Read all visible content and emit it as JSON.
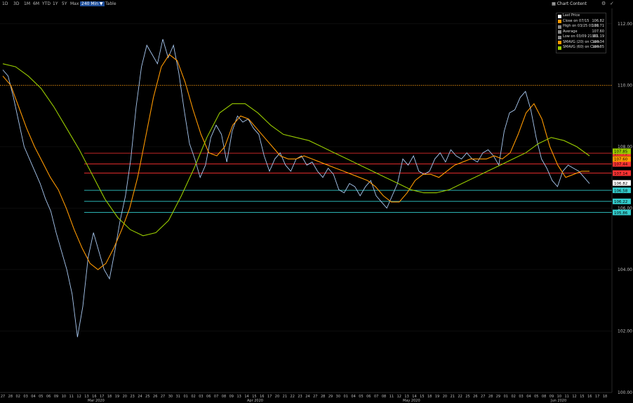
{
  "toolbar": {
    "timeframes": [
      "1D",
      "3D",
      "1M",
      "6M",
      "YTD",
      "1Y",
      "5Y",
      "Max",
      "240 Min ▼",
      "Table"
    ],
    "active": "240 Min ▼",
    "chart_content": "Chart Content"
  },
  "legend": [
    {
      "name": "Last Price",
      "value": "",
      "color": "#ffffff"
    },
    {
      "name": "Close on 07/15",
      "value": "106.82",
      "color": "#ff9900"
    },
    {
      "name": "High on 03/25 01:00",
      "value": "111.71",
      "color": "#888888"
    },
    {
      "name": "Average",
      "value": "107.60",
      "color": "#888888"
    },
    {
      "name": "Low on 03/09 21:00",
      "value": "101.19",
      "color": "#888888"
    },
    {
      "name": "SMAVG (20) on Close",
      "value": "107.34",
      "color": "#ff9900"
    },
    {
      "name": "SMAVG (60) on Close",
      "value": "107.85",
      "color": "#99cc00"
    }
  ],
  "chart_data": {
    "type": "line",
    "ylim": [
      100,
      112.5
    ],
    "yticks": [
      100,
      102,
      104,
      106,
      108,
      110,
      112
    ],
    "ytick_labels": [
      "100.00",
      "102.00",
      "104.00",
      "106.00",
      "108.00",
      "110.00",
      "112.00"
    ],
    "day_labels": [
      "27",
      "28",
      "02",
      "03",
      "04",
      "05",
      "06",
      "09",
      "10",
      "11",
      "12",
      "13",
      "16",
      "17",
      "18",
      "19",
      "20",
      "23",
      "24",
      "25",
      "26",
      "27",
      "30",
      "31",
      "01",
      "02",
      "03",
      "06",
      "07",
      "08",
      "09",
      "13",
      "14",
      "15",
      "16",
      "17",
      "20",
      "21",
      "22",
      "23",
      "24",
      "27",
      "28",
      "29",
      "30",
      "01",
      "04",
      "05",
      "06",
      "07",
      "08",
      "11",
      "12",
      "13",
      "14",
      "15",
      "18",
      "19",
      "20",
      "21",
      "22",
      "25",
      "26",
      "27",
      "28",
      "29",
      "01",
      "02",
      "03",
      "04",
      "05",
      "08",
      "09",
      "10",
      "11",
      "12",
      "15",
      "16",
      "17",
      "18"
    ],
    "month_labels": [
      "Mar 2020",
      "Apr 2020",
      "May 2020",
      "Jun 2020"
    ],
    "series": [
      {
        "name": "Last Price",
        "color": "#a8c8f0",
        "values": [
          110.5,
          110.3,
          109.6,
          108.8,
          108.0,
          107.6,
          107.2,
          106.8,
          106.3,
          105.9,
          105.2,
          104.6,
          104.0,
          103.2,
          101.8,
          102.8,
          104.4,
          105.2,
          104.6,
          104.0,
          103.7,
          104.6,
          105.6,
          106.4,
          107.6,
          109.3,
          110.6,
          111.3,
          111.0,
          110.7,
          111.5,
          110.9,
          111.3,
          110.4,
          109.2,
          108.1,
          107.6,
          107.0,
          107.4,
          108.3,
          108.7,
          108.4,
          107.5,
          108.5,
          109.0,
          108.8,
          108.9,
          108.6,
          108.4,
          107.7,
          107.2,
          107.6,
          107.8,
          107.4,
          107.2,
          107.6,
          107.7,
          107.4,
          107.5,
          107.2,
          107.0,
          107.3,
          107.1,
          106.6,
          106.5,
          106.8,
          106.7,
          106.4,
          106.7,
          106.9,
          106.4,
          106.2,
          106.0,
          106.4,
          106.8,
          107.6,
          107.4,
          107.7,
          107.2,
          107.1,
          107.2,
          107.6,
          107.8,
          107.5,
          107.9,
          107.7,
          107.6,
          107.8,
          107.6,
          107.5,
          107.8,
          107.9,
          107.7,
          107.4,
          108.5,
          109.1,
          109.2,
          109.6,
          109.8,
          109.2,
          108.3,
          107.6,
          107.3,
          106.9,
          106.7,
          107.2,
          107.4,
          107.3,
          107.2,
          107.0,
          106.8
        ]
      },
      {
        "name": "SMAVG (20) on Close",
        "color": "#ff9900",
        "values": [
          110.3,
          110.0,
          109.3,
          108.6,
          108.0,
          107.5,
          107.0,
          106.6,
          106.0,
          105.3,
          104.7,
          104.2,
          104.0,
          104.2,
          104.7,
          105.3,
          106.0,
          107.0,
          108.3,
          109.6,
          110.6,
          111.0,
          110.8,
          110.1,
          109.2,
          108.4,
          107.8,
          107.7,
          108.0,
          108.7,
          109.0,
          108.9,
          108.6,
          108.3,
          108.0,
          107.7,
          107.6,
          107.6,
          107.7,
          107.6,
          107.5,
          107.4,
          107.3,
          107.2,
          107.1,
          107.0,
          106.9,
          106.7,
          106.4,
          106.2,
          106.2,
          106.5,
          106.9,
          107.1,
          107.1,
          107.0,
          107.2,
          107.4,
          107.5,
          107.6,
          107.6,
          107.6,
          107.7,
          107.6,
          107.8,
          108.4,
          109.1,
          109.4,
          108.9,
          108.0,
          107.4,
          107.0,
          107.1,
          107.2,
          107.2
        ]
      },
      {
        "name": "SMAVG (60) on Close",
        "color": "#99cc00",
        "values": [
          110.7,
          110.6,
          110.3,
          109.9,
          109.3,
          108.6,
          107.9,
          107.1,
          106.3,
          105.7,
          105.3,
          105.1,
          105.2,
          105.6,
          106.4,
          107.3,
          108.3,
          109.1,
          109.4,
          109.4,
          109.1,
          108.7,
          108.4,
          108.3,
          108.2,
          108.0,
          107.8,
          107.6,
          107.4,
          107.2,
          107.0,
          106.8,
          106.6,
          106.5,
          106.5,
          106.6,
          106.8,
          107.0,
          107.2,
          107.4,
          107.6,
          107.8,
          108.1,
          108.3,
          108.2,
          108.0,
          107.7
        ]
      }
    ],
    "horizontal_lines": [
      {
        "value": 110.0,
        "color": "#ff9900",
        "style": "dotted",
        "label": "110.00"
      },
      {
        "value": 107.79,
        "color": "#ff3333",
        "label": "107.79"
      },
      {
        "value": 107.44,
        "color": "#ff3333",
        "label": "107.44"
      },
      {
        "value": 107.14,
        "color": "#ff3333",
        "label": "107.14"
      },
      {
        "value": 106.58,
        "color": "#33cccc",
        "label": "106.58"
      },
      {
        "value": 106.22,
        "color": "#33cccc",
        "label": "106.22"
      },
      {
        "value": 105.86,
        "color": "#33cccc",
        "label": "105.86"
      }
    ],
    "axis_labels": [
      {
        "value": 107.85,
        "color": "#99cc00",
        "label": "107.85"
      },
      {
        "value": 107.6,
        "color": "#ff9900",
        "label": "107.60"
      },
      {
        "value": 106.82,
        "color": "#ffffff",
        "label": "106.82"
      }
    ]
  }
}
